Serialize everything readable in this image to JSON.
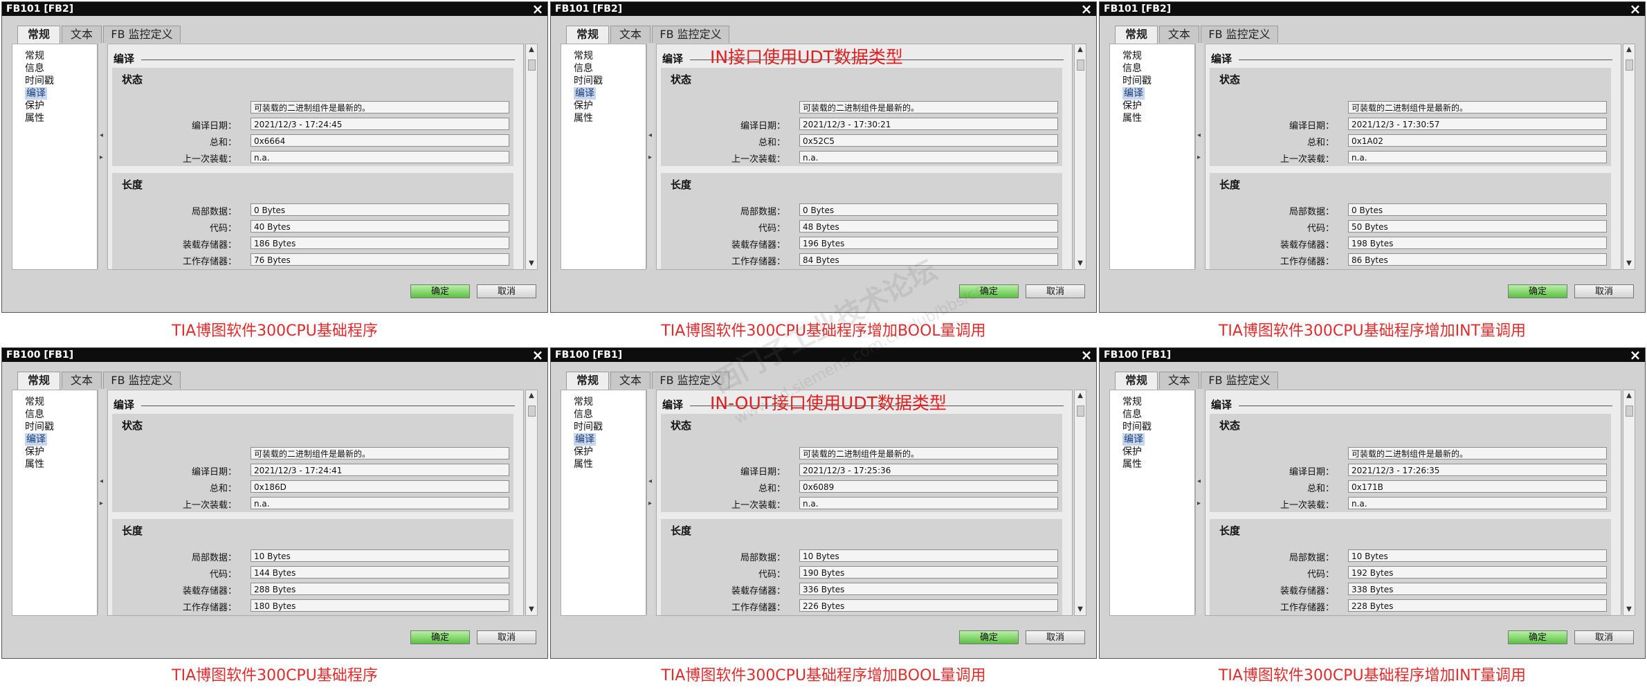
{
  "ui": {
    "tabs": [
      "常规",
      "文本",
      "FB 监控定义"
    ],
    "nav": [
      "常规",
      "信息",
      "时间戳",
      "编译",
      "保护",
      "属性"
    ],
    "compile_heading": "编译",
    "status_heading": "状态",
    "length_heading": "长度",
    "status_value": "可装载的二进制组件是最新的。",
    "status_labels": [
      "编译日期：",
      "总和：",
      "上一次装载："
    ],
    "length_labels": [
      "局部数据：",
      "代码：",
      "装载存储器：",
      "工作存储器："
    ],
    "ok_label": "确定",
    "cancel_label": "取消"
  },
  "panels": [
    {
      "title": "FB101 [FB2]",
      "annotation": "",
      "date": "2021/12/3 - 17:24:45",
      "checksum": "0x6664",
      "last_load": "n.a.",
      "local": "0 Bytes",
      "code": "40 Bytes",
      "load_mem": "186 Bytes",
      "work_mem": "76 Bytes",
      "caption": "TIA博图软件300CPU基础程序"
    },
    {
      "title": "FB101 [FB2]",
      "annotation": "IN接口使用UDT数据类型",
      "date": "2021/12/3 - 17:30:21",
      "checksum": "0x52C5",
      "last_load": "n.a.",
      "local": "0 Bytes",
      "code": "48 Bytes",
      "load_mem": "196 Bytes",
      "work_mem": "84 Bytes",
      "caption": "TIA博图软件300CPU基础程序增加BOOL量调用"
    },
    {
      "title": "FB101 [FB2]",
      "annotation": "",
      "date": "2021/12/3 - 17:30:57",
      "checksum": "0x1A02",
      "last_load": "n.a.",
      "local": "0 Bytes",
      "code": "50 Bytes",
      "load_mem": "198 Bytes",
      "work_mem": "86 Bytes",
      "caption": "TIA博图软件300CPU基础程序增加INT量调用"
    },
    {
      "title": "FB100 [FB1]",
      "annotation": "",
      "date": "2021/12/3 - 17:24:41",
      "checksum": "0x186D",
      "last_load": "n.a.",
      "local": "10 Bytes",
      "code": "144 Bytes",
      "load_mem": "288 Bytes",
      "work_mem": "180 Bytes",
      "caption": "TIA博图软件300CPU基础程序"
    },
    {
      "title": "FB100 [FB1]",
      "annotation": "IN-OUT接口使用UDT数据类型",
      "date": "2021/12/3 - 17:25:36",
      "checksum": "0x6089",
      "last_load": "n.a.",
      "local": "10 Bytes",
      "code": "190 Bytes",
      "load_mem": "336 Bytes",
      "work_mem": "226 Bytes",
      "caption": "TIA博图软件300CPU基础程序增加BOOL量调用"
    },
    {
      "title": "FB100 [FB1]",
      "annotation": "",
      "date": "2021/12/3 - 17:26:35",
      "checksum": "0x171B",
      "last_load": "n.a.",
      "local": "10 Bytes",
      "code": "192 Bytes",
      "load_mem": "338 Bytes",
      "work_mem": "228 Bytes",
      "caption": "TIA博图软件300CPU基础程序增加INT量调用"
    }
  ],
  "watermark": {
    "line1": "西门子工业技术论坛",
    "line2": "www.ad.siemens.com.cn/club/bbs/cs"
  }
}
